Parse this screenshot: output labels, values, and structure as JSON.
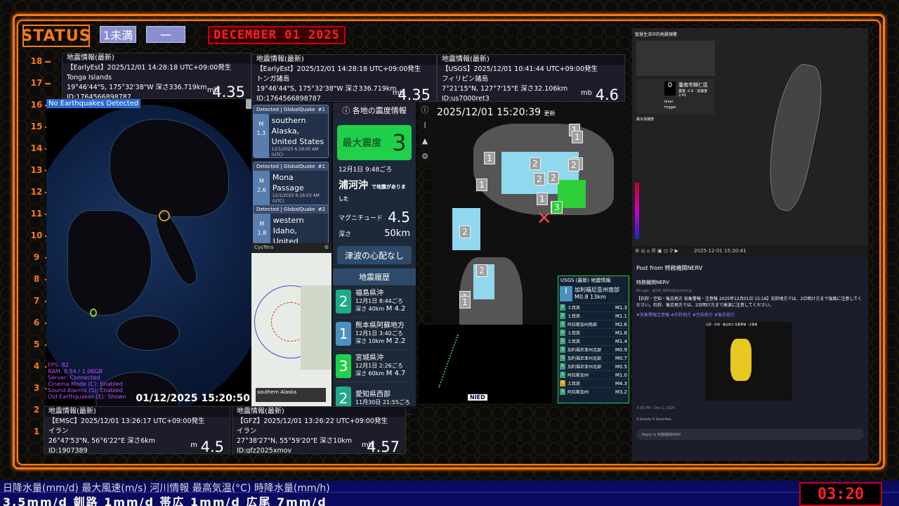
{
  "header": {
    "status": "STATUS",
    "shindo_label": "1未満",
    "shindo_label2": "一",
    "date": "DECEMBER 01 2025"
  },
  "ruler": [
    "18",
    "17",
    "16",
    "15",
    "14",
    "13",
    "12",
    "11",
    "10",
    "9",
    "8",
    "7",
    "6",
    "5",
    "4",
    "3",
    "2",
    "1"
  ],
  "cards_top": [
    {
      "hdr": "地震情報(最新)",
      "src": "【EarlyEst】2025/12/01 14:28:18 UTC+09:00発生",
      "place": "Tonga Islands",
      "coords": "19°46'44\"S, 175°32'38\"W 深さ336.719km",
      "id": "ID:1764566898787",
      "mtype": "mb",
      "mag": "4.35"
    },
    {
      "hdr": "地震情報(最新)",
      "src": "【EarlyEst】2025/12/01 14:28:18 UTC+09:00発生",
      "place": "トンガ諸島",
      "coords": "19°46'44\"S, 175°32'38\"W 深さ336.719km",
      "id": "ID:1764566898787",
      "mtype": "mb",
      "mag": "4.35"
    },
    {
      "hdr": "地震情報(最新)",
      "src": "【USGS】2025/12/01 10:41:44 UTC+09:00発生",
      "place": "フィリピン諸島",
      "coords": "7°21'15\"N, 127°7'15\"E 深さ32.106km",
      "id": "ID:us7000ret3",
      "mtype": "mb",
      "mag": "4.6"
    }
  ],
  "cards_bottom": [
    {
      "hdr": "地震情報(最新)",
      "src": "【EMSC】2025/12/01 13:26:17 UTC+09:00発生",
      "place": "イラン",
      "coords": "26°47'53\"N, 56°6'22\"E 深さ6km",
      "id": "ID:1907389",
      "mtype": "m",
      "mag": "4.5"
    },
    {
      "hdr": "地震情報(最新)",
      "src": "【GFZ】2025/12/01 13:26:22 UTC+09:00発生",
      "place": "イラン",
      "coords": "27°38'27\"N, 55°59'20\"E 深さ10km",
      "id": "ID:gfz2025xmov",
      "mtype": "mb",
      "mag": "4.57"
    }
  ],
  "globe": {
    "badge": "No Earthquakes Detected",
    "timestamp": "01/12/2025 15:20:50",
    "status_lines": [
      "FPS: 82",
      "RAM: 0.54 / 1.06GB",
      "Server: Connected",
      "Cinema Mode (C): Enabled",
      "Sound Alarms (S): Enabled",
      "Old Earthquakes (E): Shown"
    ]
  },
  "gq_cards": [
    {
      "head": "Detected | GlobalQuake",
      "num": "#1",
      "m": "M",
      "mval": "1.3",
      "place1": "southern Alaska,",
      "place2": "United States",
      "meta1": "12/1/2025 6:19:05 AM (UTC)",
      "meta2": "Depth 0.2km  Quality 0"
    },
    {
      "head": "Detected | GlobalQuake",
      "num": "#1",
      "m": "M",
      "mval": "2.6",
      "place1": "Mona Passage",
      "place2": "",
      "meta1": "12/1/2025 6:16:03 AM (UTC)",
      "meta2": "Depth 27.4km  Quality 5"
    },
    {
      "head": "Detected | GlobalQuake",
      "num": "#2",
      "m": "M",
      "mval": "1.8",
      "place1": "western Idaho,",
      "place2": "United States",
      "meta1": "",
      "meta2": ""
    }
  ],
  "cystera": {
    "title": "CysTera",
    "caption": "southern Alaska"
  },
  "shindo": {
    "title": "ⓘ 各地の震度情報",
    "max_label": "最大震度",
    "max_val": "3",
    "time": "12月1日 9:48ごろ",
    "place": "浦河沖",
    "place_sfx": "で地震がありました",
    "mag_label": "マグニチュード",
    "mag": "4.5",
    "depth_label": "深さ",
    "depth": "50km",
    "tsunami": "津波の心配なし",
    "history_title": "地震履歴"
  },
  "history": [
    {
      "int": "2",
      "color": "#1faa8a",
      "place": "福島県沖",
      "time": "12月1日 8:44ごろ",
      "depth": "深さ 40km",
      "mag": "M 4.2"
    },
    {
      "int": "1",
      "color": "#4a90c0",
      "place": "熊本県阿蘇地方",
      "time": "12月1日 3:40ごろ",
      "depth": "深さ 10km",
      "mag": "M 2.2"
    },
    {
      "int": "3",
      "color": "#1fd04a",
      "place": "宮城県沖",
      "time": "12月1日 2:26ごろ",
      "depth": "深さ 60km",
      "mag": "M 4.7"
    },
    {
      "int": "2",
      "color": "#1faa8a",
      "place": "愛知県西部",
      "time": "11月30日 21:55ごろ",
      "depth": "",
      "mag": ""
    }
  ],
  "jpmap": {
    "timestamp": "2025/12/01 15:20:39",
    "update": "更新",
    "tags": [
      "1",
      "1",
      "2",
      "2",
      "1",
      "1",
      "2",
      "2",
      "2",
      "1",
      "2",
      "3",
      "2",
      "2",
      "1",
      "1"
    ]
  },
  "usgs": {
    "title": "USGS (最新) 地震情報",
    "place": "加利福尼亚州南部",
    "mag": "M0.8",
    "depth": "13km",
    "rows": [
      [
        "1",
        "土耳其",
        "M1.3"
      ],
      [
        "1",
        "土耳其",
        "M1.1"
      ],
      [
        "1",
        "阿拉斯加州南部",
        "M2.6"
      ],
      [
        "1",
        "土耳其",
        "M1.8"
      ],
      [
        "1",
        "土耳其",
        "M1.4"
      ],
      [
        "1",
        "加利福尼亚州北部",
        "M0.9"
      ],
      [
        "1",
        "加利福尼亚州北部",
        "M0.7"
      ],
      [
        "1",
        "加利福尼亚州北部",
        "M0.5"
      ],
      [
        "1",
        "阿拉斯加州",
        "M1.0"
      ],
      [
        "4",
        "土耳其",
        "M4.3"
      ],
      [
        "1",
        "阿拉斯加州",
        "M3.2"
      ]
    ]
  },
  "nied": {
    "logo": "NIED"
  },
  "taiwan": {
    "title": "智慧生活中的地震預警",
    "val": "0",
    "place": "臺南市歸仁區",
    "sub": "震度 -2.9 · 加速度 2.41",
    "small_a": "level",
    "small_b": "trigger",
    "footer_label": "最大加速度",
    "timestamp": "2025-12-01 15:20:41"
  },
  "nerv": {
    "post_from": "Post from 特務機関NERV",
    "account": "特務機関NERV",
    "handle": "No ago · @UN_NERV@unnerv.jp",
    "text": "【石狩・空知・後志地方 気象警報・注意報 2025年12月01日 15:16】石狩地方では、2日明け方まで強風に注意してください。石狩、後志地方では、2日明け方まで高波に注意してください。",
    "tags": "#気象警報注意報 #石狩地方 #空知地方 #後志地方",
    "map_title": "石狩・空知・後志地方 気象警報・注意報",
    "footer_time": "3:16 PM · Dec 1, 2025",
    "stats": "3 boosts  0 favorites",
    "reply": "Reply to 特務機関NERV"
  },
  "ticker": {
    "top": "日降水量(mm/d)  最大風速(m/s)   河川情報    最高気温(°C)   時降水量(mm/h)",
    "bottom": "3.5mm/d   釧路 1mm/d   帯広 1mm/d   広尾 7mm/d"
  },
  "clock": "03:20"
}
